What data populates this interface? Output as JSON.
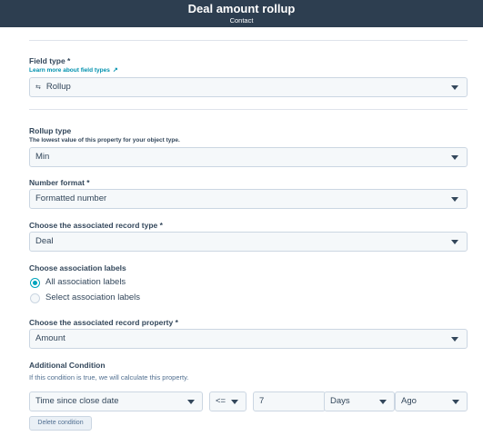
{
  "header": {
    "title": "Deal amount rollup",
    "subtitle": "Contact"
  },
  "field_type": {
    "label": "Field type *",
    "link": "Learn more about field types",
    "link_icon": "↗",
    "icon": "⇆",
    "value": "Rollup"
  },
  "rollup_type": {
    "label": "Rollup type",
    "help": "The lowest value of this property for your object type.",
    "value": "Min"
  },
  "number_format": {
    "label": "Number format *",
    "value": "Formatted number"
  },
  "record_type": {
    "label": "Choose the associated record type *",
    "value": "Deal"
  },
  "association_labels": {
    "label": "Choose association labels",
    "options": [
      {
        "label": "All association labels",
        "checked": true
      },
      {
        "label": "Select association labels",
        "checked": false
      }
    ]
  },
  "record_property": {
    "label": "Choose the associated record property *",
    "value": "Amount"
  },
  "condition": {
    "label": "Additional Condition",
    "help": "If this condition is true, we will calculate this property.",
    "property": "Time since close date",
    "operator": "<=",
    "amount": "7",
    "unit": "Days",
    "direction": "Ago",
    "delete_label": "Delete condition"
  },
  "colors": {
    "header_bg": "#2d3e50",
    "accent": "#00a4bd",
    "link": "#0091ae"
  }
}
